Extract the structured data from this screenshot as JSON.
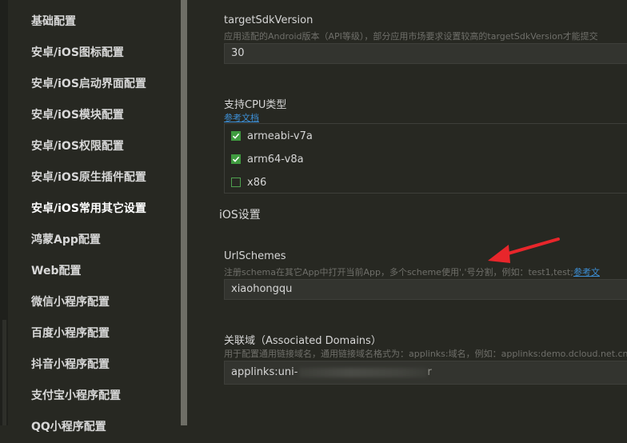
{
  "sidebar": {
    "items": [
      {
        "label": "基础配置"
      },
      {
        "label": "安卓/iOS图标配置"
      },
      {
        "label": "安卓/iOS启动界面配置"
      },
      {
        "label": "安卓/iOS模块配置"
      },
      {
        "label": "安卓/iOS权限配置"
      },
      {
        "label": "安卓/iOS原生插件配置"
      },
      {
        "label": "安卓/iOS常用其它设置"
      },
      {
        "label": "鸿蒙App配置"
      },
      {
        "label": "Web配置"
      },
      {
        "label": "微信小程序配置"
      },
      {
        "label": "百度小程序配置"
      },
      {
        "label": "抖音小程序配置"
      },
      {
        "label": "支付宝小程序配置"
      },
      {
        "label": "QQ小程序配置"
      }
    ],
    "active_index": 6
  },
  "main": {
    "target_sdk": {
      "label": "targetSdkVersion",
      "hint": "应用适配的Android版本（API等级），部分应用市场要求设置较高的targetSdkVersion才能提交",
      "value": "30"
    },
    "cpu": {
      "label": "支持CPU类型",
      "doc_link": "参考文档",
      "options": [
        {
          "label": "armeabi-v7a",
          "checked": true
        },
        {
          "label": "arm64-v8a",
          "checked": true
        },
        {
          "label": "x86",
          "checked": false
        }
      ]
    },
    "ios_section_title": "iOS设置",
    "url_schemes": {
      "label": "UrlSchemes",
      "hint": "注册schema在其它App中打开当前App，多个scheme使用','号分割，例如：test1,test;",
      "hint_link": "参考文",
      "value": "xiaohongqu"
    },
    "associated_domains": {
      "label": "关联域（Associated Domains）",
      "hint": "用于配置通用链接域名，通用链接域名格式为：applinks:域名，例如：applinks:demo.dcloud.net.cn",
      "value_prefix": "applinks:uni-",
      "value_suffix": "r"
    }
  },
  "colors": {
    "background": "#272822",
    "field_bg": "#33342f",
    "checkbox_green": "#3f9b3f",
    "link_blue": "#3d8fd6",
    "arrow_red": "#e8262b"
  }
}
